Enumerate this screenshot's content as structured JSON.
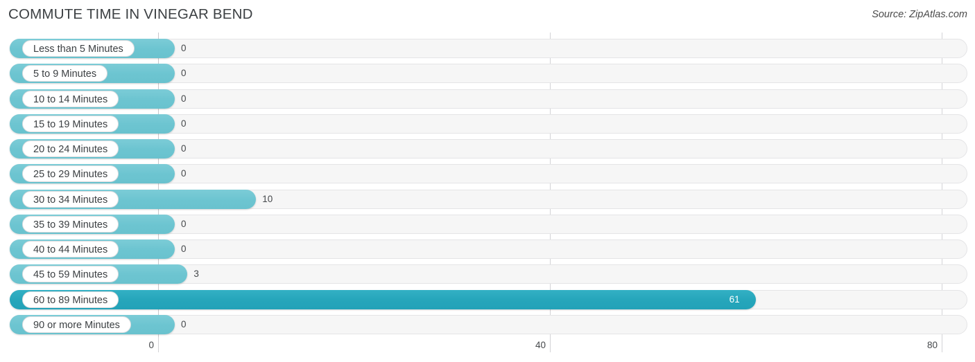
{
  "header": {
    "title": "COMMUTE TIME IN VINEGAR BEND",
    "source": "Source: ZipAtlas.com"
  },
  "colors": {
    "bar_light": "#6dc5d1",
    "bar_dark": "#26a6bb",
    "track": "#f6f6f6",
    "grid": "#d3d3d6",
    "text": "#3c4043"
  },
  "chart_data": {
    "type": "bar",
    "orientation": "horizontal",
    "title": "COMMUTE TIME IN VINEGAR BEND",
    "xlabel": "",
    "ylabel": "",
    "xlim": [
      0,
      80
    ],
    "xticks": [
      0,
      40,
      80
    ],
    "xtick_labels": [
      "0",
      "40",
      "80"
    ],
    "grid": true,
    "legend": "none",
    "categories": [
      "Less than 5 Minutes",
      "5 to 9 Minutes",
      "10 to 14 Minutes",
      "15 to 19 Minutes",
      "20 to 24 Minutes",
      "25 to 29 Minutes",
      "30 to 34 Minutes",
      "35 to 39 Minutes",
      "40 to 44 Minutes",
      "45 to 59 Minutes",
      "60 to 89 Minutes",
      "90 or more Minutes"
    ],
    "values": [
      0,
      0,
      0,
      0,
      0,
      0,
      10,
      0,
      0,
      3,
      61,
      0
    ],
    "value_labels": [
      "0",
      "0",
      "0",
      "0",
      "0",
      "0",
      "10",
      "0",
      "0",
      "3",
      "61",
      "0"
    ],
    "highlight_index": 10
  }
}
